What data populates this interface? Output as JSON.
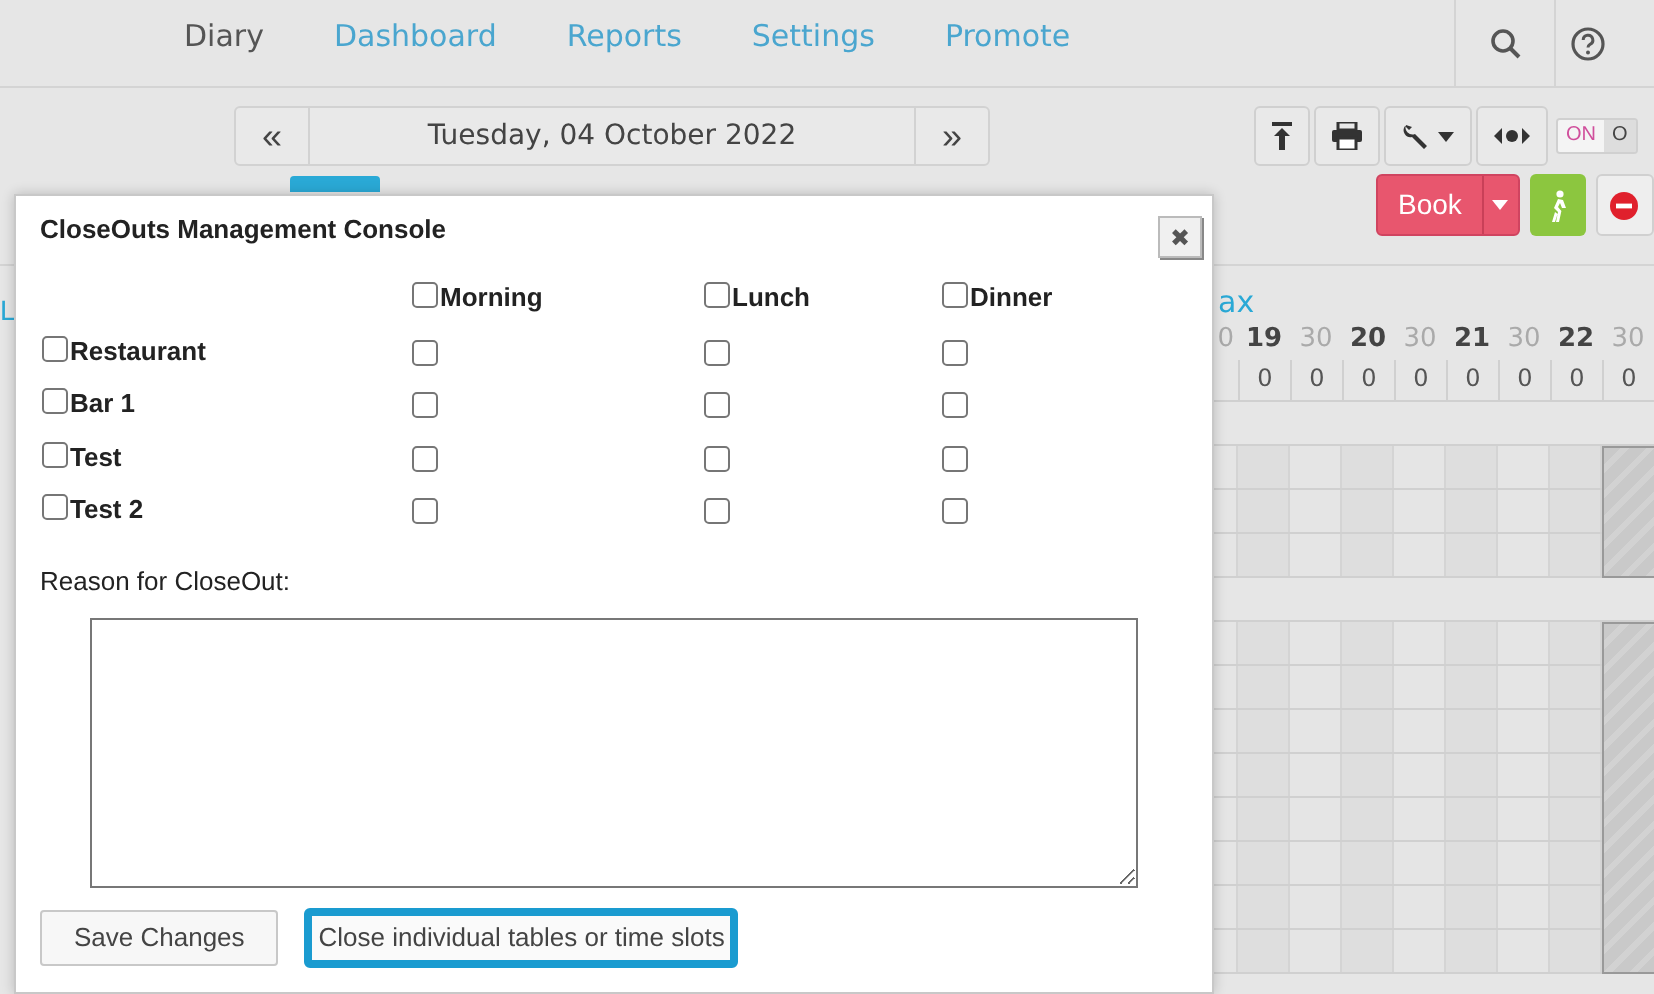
{
  "nav": {
    "items": [
      {
        "label": "Diary",
        "selected": true
      },
      {
        "label": "Dashboard",
        "selected": false
      },
      {
        "label": "Reports",
        "selected": false
      },
      {
        "label": "Settings",
        "selected": false
      },
      {
        "label": "Promote",
        "selected": false
      }
    ]
  },
  "date_nav": {
    "prev": "«",
    "date": "Tuesday, 04 October 2022",
    "next": "»"
  },
  "toggle": {
    "on_label": "ON",
    "off_label": "O",
    "on": true
  },
  "book_button": "Book",
  "timeline": {
    "left_fragment": "L",
    "header_fragment": "ax",
    "times": [
      {
        "label": "0",
        "hour": false
      },
      {
        "label": "19",
        "hour": true
      },
      {
        "label": "30",
        "hour": false
      },
      {
        "label": "20",
        "hour": true
      },
      {
        "label": "30",
        "hour": false
      },
      {
        "label": "21",
        "hour": true
      },
      {
        "label": "30",
        "hour": false
      },
      {
        "label": "22",
        "hour": true
      },
      {
        "label": "30",
        "hour": false
      }
    ],
    "counts": [
      "0",
      "0",
      "0",
      "0",
      "0",
      "0",
      "0",
      "0"
    ]
  },
  "modal": {
    "title": "CloseOuts Management Console",
    "close": "✖",
    "sessions": [
      {
        "label": "Morning",
        "checked": false
      },
      {
        "label": "Lunch",
        "checked": false
      },
      {
        "label": "Dinner",
        "checked": false
      }
    ],
    "areas": [
      {
        "label": "Restaurant",
        "checked": false,
        "slots": [
          {
            "checked": false
          },
          {
            "checked": false
          },
          {
            "checked": false
          }
        ]
      },
      {
        "label": "Bar 1",
        "checked": false,
        "slots": [
          {
            "checked": false
          },
          {
            "checked": false
          },
          {
            "checked": false
          }
        ]
      },
      {
        "label": "Test",
        "checked": false,
        "slots": [
          {
            "checked": false
          },
          {
            "checked": false
          },
          {
            "checked": false
          }
        ]
      },
      {
        "label": "Test 2",
        "checked": false,
        "slots": [
          {
            "checked": false
          },
          {
            "checked": false
          },
          {
            "checked": false
          }
        ]
      }
    ],
    "reason_label": "Reason for CloseOut:",
    "buttons": [
      {
        "label": "Save Changes",
        "focused": false
      },
      {
        "label": "Close individual tables or time slots",
        "focused": true
      }
    ]
  }
}
